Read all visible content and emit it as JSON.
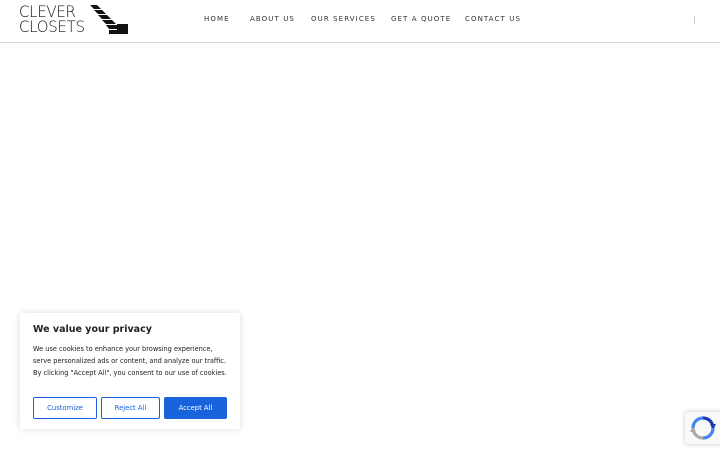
{
  "header": {
    "logo": {
      "line1": "CLEVER",
      "line2": "CLOSETS"
    },
    "nav": [
      {
        "label": "HOME"
      },
      {
        "label": "ABOUT US"
      },
      {
        "label": "OUR SERVICES"
      },
      {
        "label": "GET A QUOTE"
      },
      {
        "label": "CONTACT US"
      }
    ]
  },
  "cookie_banner": {
    "title": "We value your privacy",
    "text": "We use cookies to enhance your browsing experience, serve personalized ads or content, and analyze our traffic. By clicking \"Accept All\", you consent to our use of cookies.",
    "buttons": {
      "customize": "Customize",
      "reject": "Reject All",
      "accept": "Accept All"
    },
    "accent_color": "#1863dc"
  },
  "recaptcha": {
    "icon": "recaptcha-icon"
  }
}
